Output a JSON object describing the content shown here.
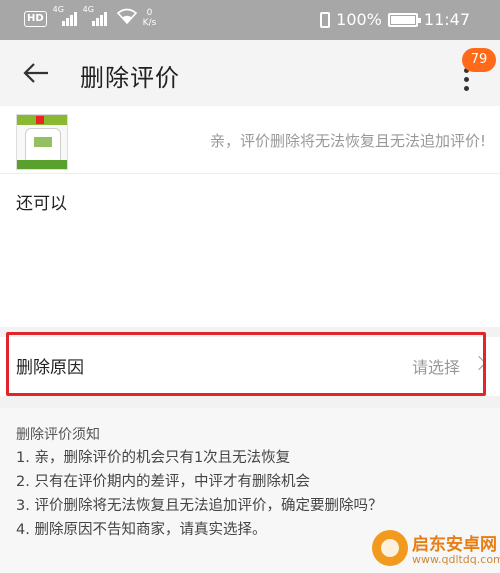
{
  "status_bar": {
    "hd_badge": "HD",
    "network_1": "4G",
    "network_2": "4G",
    "speed_value": "0",
    "speed_unit": "K/s",
    "battery_text": "100%",
    "battery_level": 1.0,
    "time": "11:47"
  },
  "header": {
    "title": "删除评价",
    "badge_count": "79",
    "back_icon": "arrow-left-icon",
    "more_icon": "more-vertical-icon"
  },
  "product": {
    "warning": "亲，评价删除将无法恢复且无法追加评价!"
  },
  "comment": {
    "text": "还可以"
  },
  "reason": {
    "label": "删除原因",
    "placeholder": "请选择"
  },
  "notice": {
    "title": "删除评价须知",
    "items": [
      "1. 亲，删除评价的机会只有1次且无法恢复",
      "2. 只有在评价期内的差评，中评才有删除机会",
      "3. 评价删除将无法恢复且无法追加评价，确定要删除吗？",
      "4. 删除原因不告知商家，请真实选择。"
    ]
  },
  "watermark": {
    "name": "启东安卓网",
    "url": "www.qdltdq.com"
  },
  "colors": {
    "accent_badge": "#ff6a1a",
    "highlight": "#e0262a",
    "status_bar": "#a7a7a7"
  }
}
